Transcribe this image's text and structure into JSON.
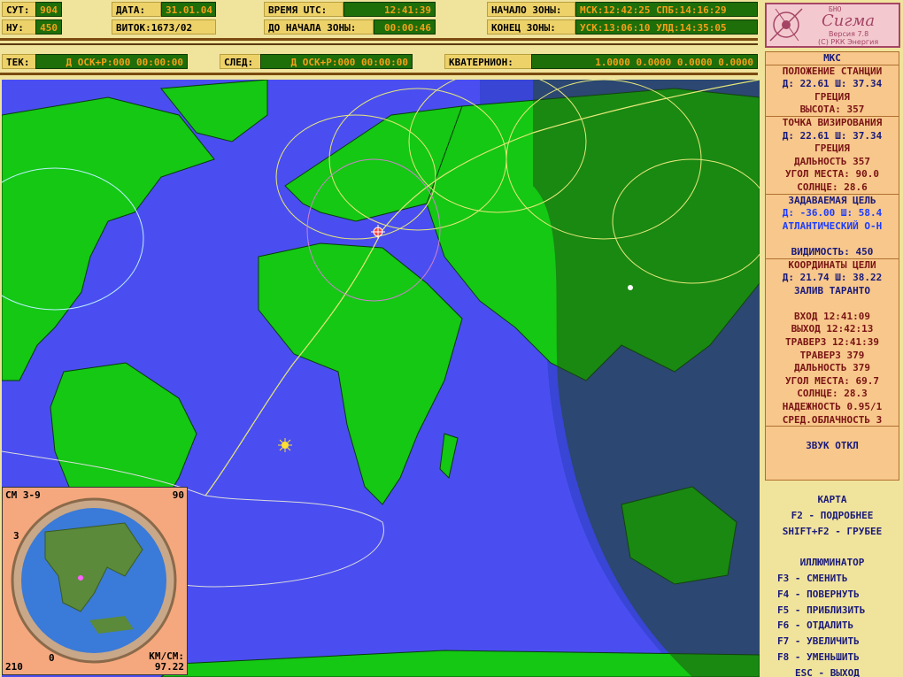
{
  "header_row1": [
    {
      "label": "СУТ:",
      "value": "904"
    },
    {
      "label": "ДАТА:",
      "value": "31.01.04"
    },
    {
      "label": "ВРЕМЯ UTC:",
      "value": "12:41:39"
    },
    {
      "label": "НАЧАЛО ЗОНЫ:",
      "value": "МСК:12:42:25 СПБ:14:16:29"
    }
  ],
  "header_row2": [
    {
      "label": "НУ:",
      "value": "450"
    },
    {
      "label": "ВИТОК:",
      "value": "1673/02"
    },
    {
      "label": "ДО НАЧАЛА ЗОНЫ:",
      "value": "00:00:46"
    },
    {
      "label": "КОНЕЦ ЗОНЫ:",
      "value": "УСК:13:06:10 УЛД:14:35:05"
    }
  ],
  "header_row3": {
    "tek_label": "ТЕК:",
    "tek_value": "Д ОСК+Р:000 00:00:00",
    "sled_label": "СЛЕД:",
    "sled_value": "Д ОСК+Р:000 00:00:00",
    "quat_label": "КВАТЕРНИОН:",
    "quat_value": "1.0000  0.0000  0.0000  0.0000"
  },
  "logo": {
    "top": "БНО",
    "name": "Сигма",
    "version": "Версия 7.8",
    "copyright": "(С) РКК Энергия"
  },
  "side": {
    "title": "МКС",
    "station_label": "ПОЛОЖЕНИЕ СТАНЦИИ",
    "station_coords": "Д: 22.61 Ш: 37.34",
    "station_region": "ГРЕЦИЯ",
    "altitude": "ВЫСОТА:   357",
    "aim_label": "ТОЧКА ВИЗИРОВАНИЯ",
    "aim_coords": "Д: 22.61 Ш: 37.34",
    "aim_region": "ГРЕЦИЯ",
    "range": "ДАЛЬНОСТЬ   357",
    "elev": "УГОЛ МЕСТА: 90.0",
    "sun": "СОЛНЦЕ: 28.6",
    "target_label": "ЗАДАВАЕМАЯ ЦЕЛЬ",
    "target_coords": "Д: -36.00 Ш:  58.4",
    "target_region": "АТЛАНТИЧЕСКИЙ О-Н",
    "visibility": "ВИДИМОСТЬ:  450",
    "tcoord_label": "КООРДИНАТЫ ЦЕЛИ",
    "tcoord_coords": "Д: 21.74 Ш: 38.22",
    "tcoord_region": "ЗАЛИВ ТАРАНТО",
    "entry": "ВХОД    12:41:09",
    "exit": "ВЫХОД   12:42:13",
    "traverse_time": "ТРАВЕРЗ 12:41:39",
    "traverse": "ТРАВЕРЗ   379",
    "range2": "ДАЛЬНОСТЬ   379",
    "elev2": "УГОЛ МЕСТА: 69.7",
    "sun2": "СОЛНЦЕ: 28.3",
    "reliability": "НАДЕЖНОСТЬ 0.95/1",
    "clouds": "СРЕД.ОБЛАЧНОСТЬ  3",
    "sound": "ЗВУК ОТКЛ"
  },
  "help": [
    "КАРТА",
    "F2 - ПОДРОБНЕЕ",
    "SHIFT+F2 - ГРУБЕЕ",
    "",
    "ИЛЛЮМИНАТОР",
    "F3 - СМЕНИТЬ",
    "F4 - ПОВЕРНУТЬ",
    "F5 - ПРИБЛИЗИТЬ",
    "F6 - ОТДАЛИТЬ",
    "F7 - УВЕЛИЧИТЬ",
    "F8 - УМЕНЬШИТЬ",
    "ESC - ВЫХОД"
  ],
  "inset": {
    "cm": "СМ 3-9",
    "top_right": "90",
    "bottom_left": "210",
    "scale_label": "КМ/СМ:",
    "scale_value": "97.22",
    "left_tick": "3",
    "bottom_tick": "0"
  },
  "colors": {
    "ocean": "#4a4ef0",
    "land": "#14c814",
    "night": "#2e6d14",
    "orbit": "#e8e87a",
    "ring": "#bdf0ff"
  }
}
